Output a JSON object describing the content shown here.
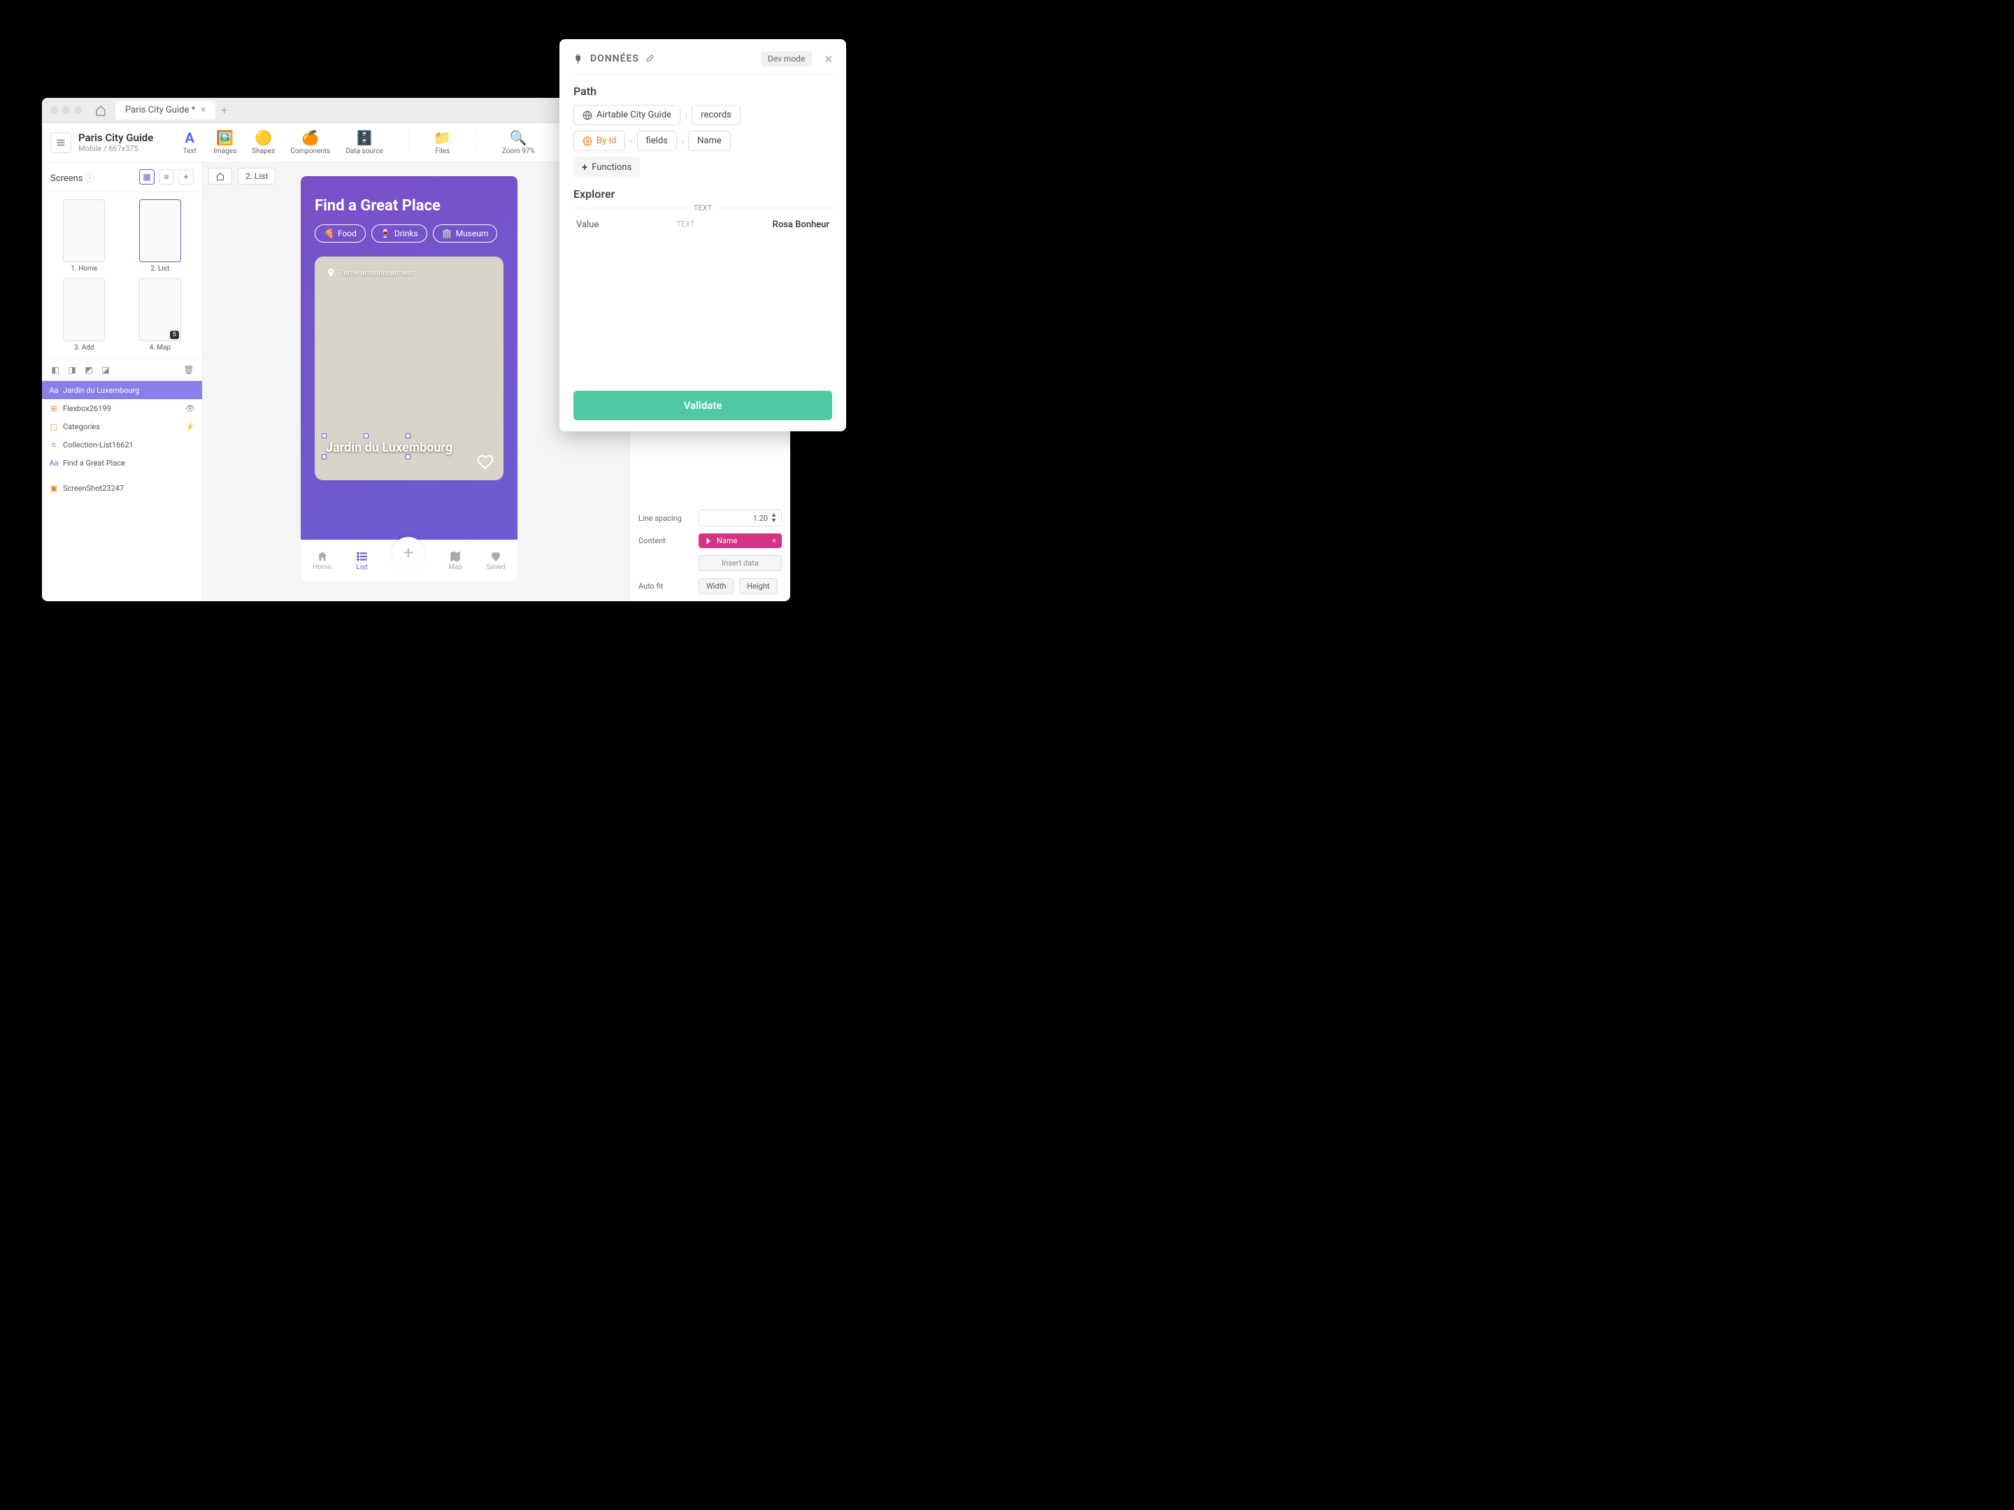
{
  "tab": {
    "title": "Paris City Guide *"
  },
  "project": {
    "name": "Paris City Guide",
    "sub": "Mobile / 667x375"
  },
  "tools": {
    "text": "Text",
    "images": "Images",
    "shapes": "Shapes",
    "components": "Components",
    "datasource": "Data source",
    "files": "Files",
    "zoom": "Zoom 97%"
  },
  "screens": {
    "header": "Screens",
    "items": [
      {
        "label": "1. Home"
      },
      {
        "label": "2. List"
      },
      {
        "label": "3. Add"
      },
      {
        "label": "4. Map",
        "badge": "5"
      }
    ]
  },
  "layers": [
    {
      "icon": "Aa",
      "name": "Jardin du  Luxembourg",
      "selected": true
    },
    {
      "icon": "⊞",
      "name": "Flexbox26199",
      "trail": "👁"
    },
    {
      "icon": "▢",
      "name": "Categories",
      "trail": "⚡"
    },
    {
      "icon": "≡",
      "name": "Collection-List16621"
    },
    {
      "icon": "Aa",
      "name": "Find a Great Place"
    },
    {
      "icon": "▣",
      "name": "ScreenShot23247"
    }
  ],
  "breadcrumb": {
    "current": "2. List"
  },
  "phone": {
    "title": "Find a Great Place",
    "chips": [
      {
        "emoji": "🍕",
        "label": "Food"
      },
      {
        "emoji": "🍷",
        "label": "Drinks"
      },
      {
        "emoji": "🏛️",
        "label": "Museum"
      }
    ],
    "card": {
      "location": "7ème arrondissement",
      "name": "Jardin du Luxembourg"
    },
    "nav": [
      {
        "label": "Home"
      },
      {
        "label": "List",
        "active": true
      },
      {
        "label": "Add"
      },
      {
        "label": "Map"
      },
      {
        "label": "Saved"
      }
    ]
  },
  "props": {
    "linespacing": {
      "label": "Line spacing",
      "value": "1.20"
    },
    "content": {
      "label": "Content",
      "tag": "Name"
    },
    "insert": "Insert data",
    "autofit": {
      "label": "Auto fit",
      "width": "Width",
      "height": "Height"
    }
  },
  "datapanel": {
    "title": "DONNÉES",
    "devmode": "Dev mode",
    "path_label": "Path",
    "path": {
      "source": "Airtable City Guide",
      "records": "records",
      "byid": "By Id",
      "fields": "fields",
      "name": "Name",
      "functions": "Functions"
    },
    "explorer_label": "Explorer",
    "explorer": {
      "badge": "TEXT",
      "value_label": "Value",
      "type": "TEXT",
      "value": "Rosa Bonheur"
    },
    "validate": "Validate"
  }
}
